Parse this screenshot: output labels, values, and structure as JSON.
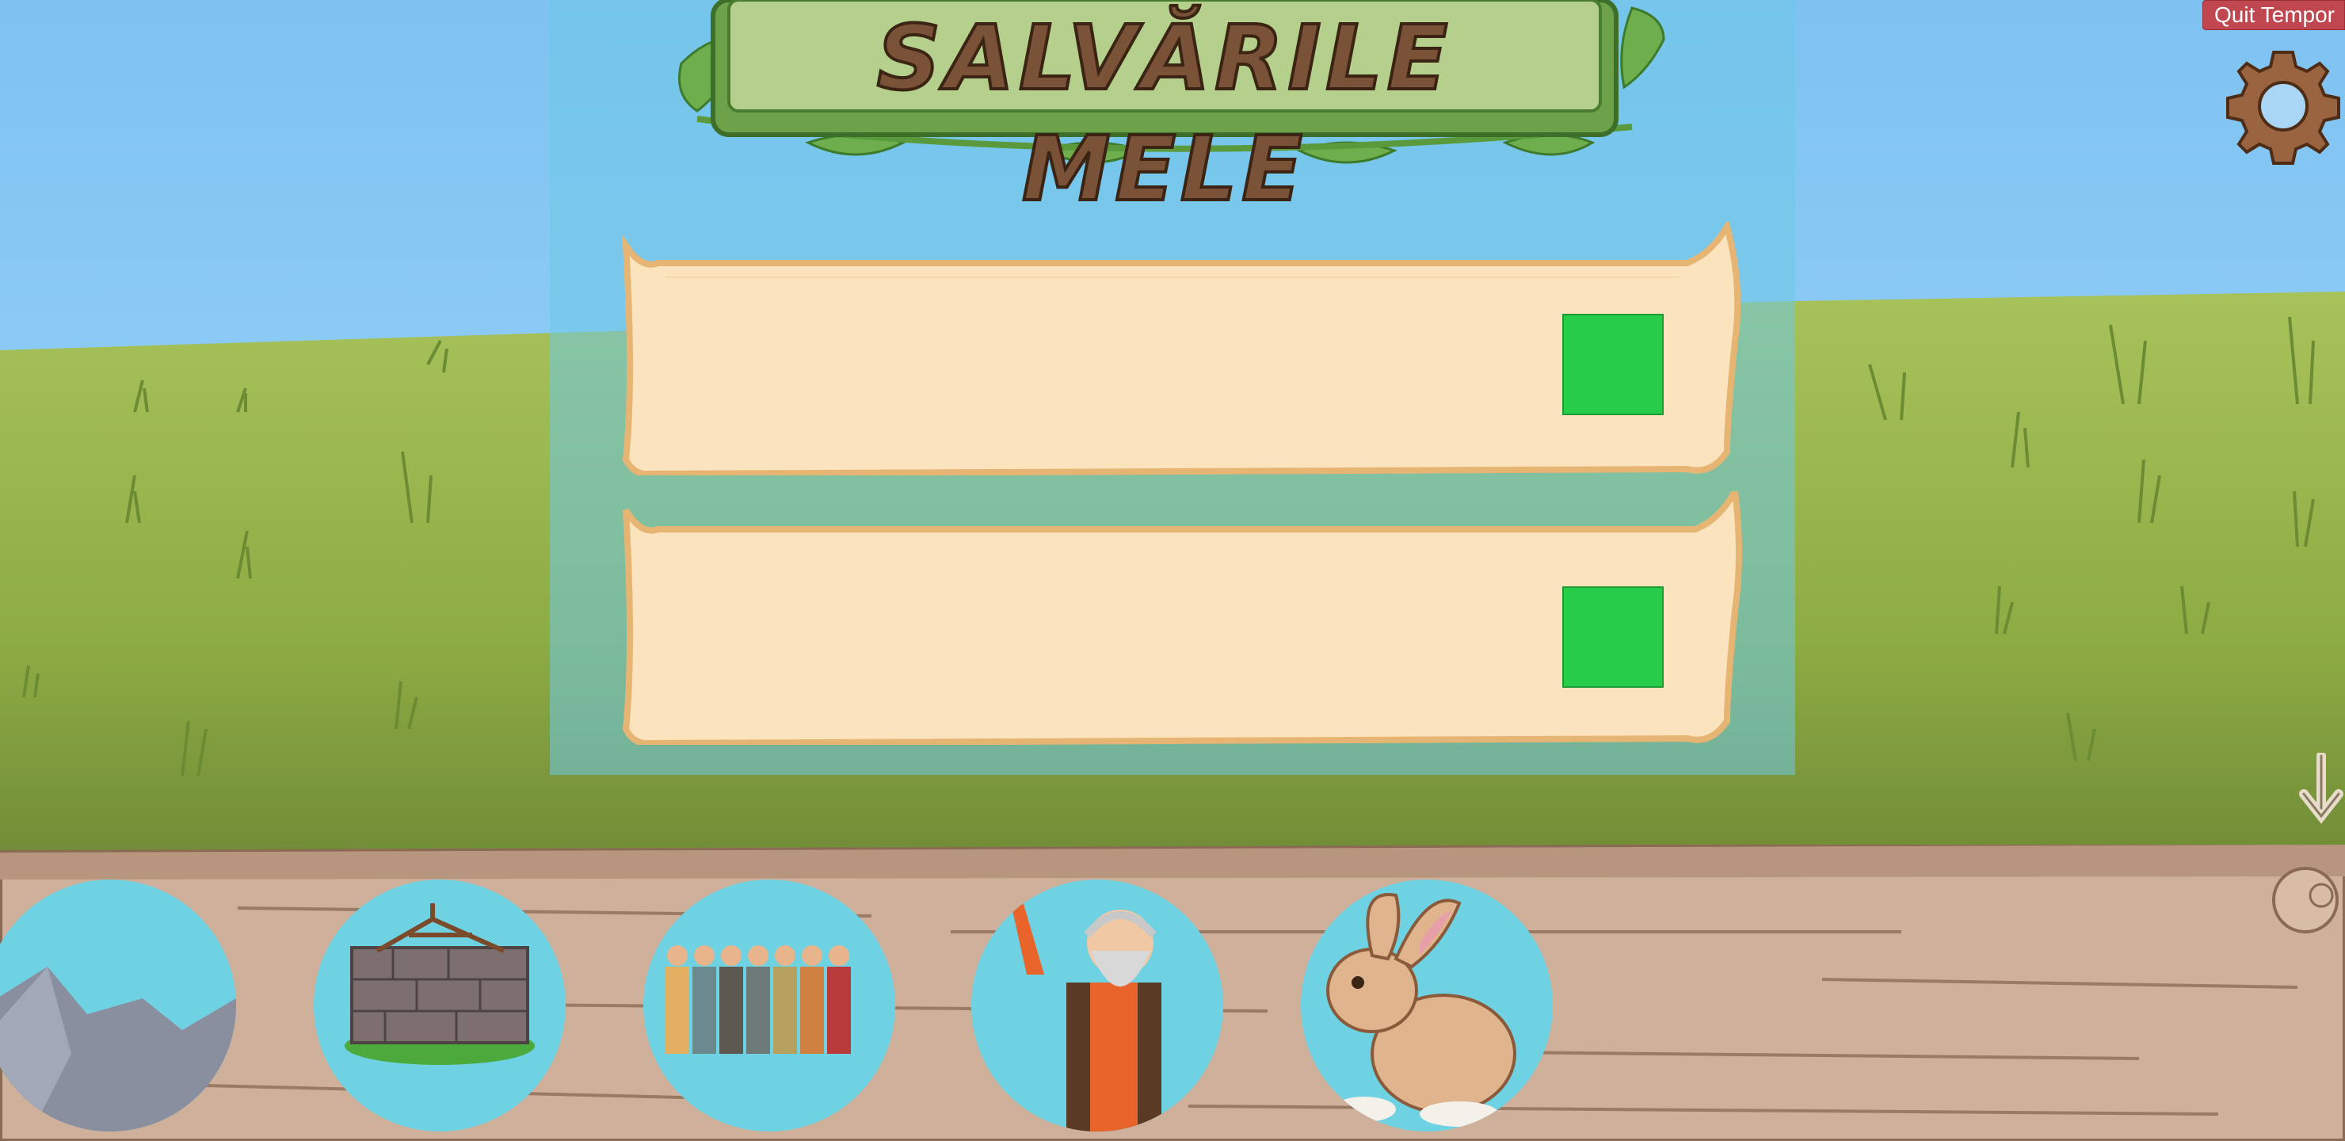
{
  "screen": {
    "title": "SALVĂRILE MELE",
    "quit_button": "Quit Tempor",
    "settings_icon": "gear-icon",
    "scroll_icon": "arrow-down-icon"
  },
  "save_slots": [
    {
      "button_color": "#26cd48"
    },
    {
      "button_color": "#26cd48"
    }
  ],
  "characters": [
    {
      "icon": "mountain-icon"
    },
    {
      "icon": "stone-altar-icon"
    },
    {
      "icon": "people-group-icon"
    },
    {
      "icon": "old-man-icon"
    },
    {
      "icon": "rabbit-icon"
    }
  ],
  "colors": {
    "sky": "#8cc8f0",
    "grass": "#9ab84a",
    "parchment": "#fbe3bd",
    "quit": "#c0474f",
    "slot_button": "#26cd48",
    "circle": "#6fd2e2"
  }
}
